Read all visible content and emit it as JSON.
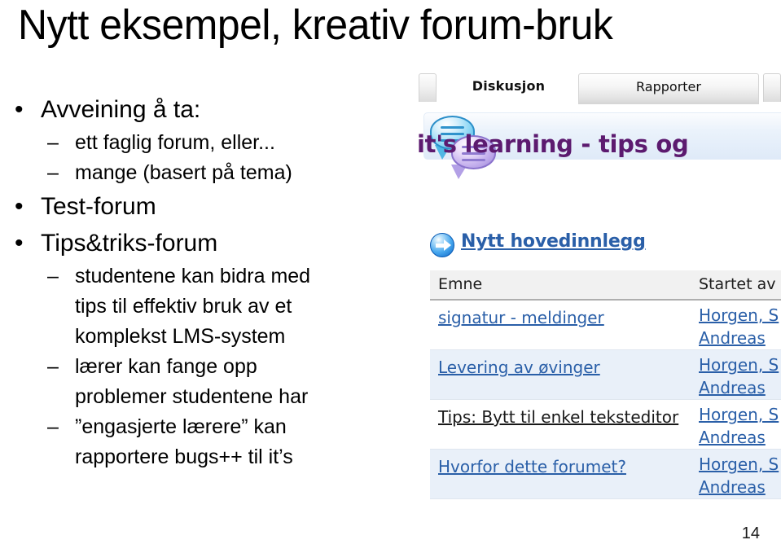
{
  "slide": {
    "title": "Nytt eksempel, kreativ forum-bruk",
    "number": "14",
    "bullet_mark_level1": "•",
    "bullet_mark_level2": "–",
    "bullets": [
      {
        "level": 1,
        "text": "Avveining å ta:"
      },
      {
        "level": 2,
        "text": "ett faglig forum, eller..."
      },
      {
        "level": 2,
        "text": "mange (basert på tema)"
      },
      {
        "level": 1,
        "text": "Test-forum"
      },
      {
        "level": 1,
        "text": "Tips&triks-forum"
      },
      {
        "level": 2,
        "lines": [
          "studentene kan bidra med",
          "tips til effektiv bruk av et",
          "komplekst LMS-system"
        ]
      },
      {
        "level": 2,
        "lines": [
          "lærer kan fange opp",
          "problemer studentene har"
        ]
      },
      {
        "level": 2,
        "lines": [
          "”engasjerte lærere” kan",
          "rapportere bugs++ til it’s"
        ]
      }
    ]
  },
  "screenshot": {
    "tabs": [
      {
        "label": "Diskusjon",
        "active": true
      },
      {
        "label": "Rapporter",
        "active": false
      }
    ],
    "forum_title": "it's learning - tips og",
    "forum_title_color": "#5c1a6f",
    "forum_icon_blue": "speech-bubble-blue-icon",
    "forum_icon_purple": "speech-bubble-purple-icon",
    "new_post": {
      "label": "Nytt hovedinnlegg",
      "icon": "arrow-right-circle-icon"
    },
    "table": {
      "columns": [
        "Emne",
        "Startet av"
      ],
      "rows": [
        {
          "topic": "signatur - meldinger",
          "author_first": "Horgen, S",
          "author_second": "Andreas",
          "visited": false
        },
        {
          "topic": "Levering av øvinger",
          "author_first": "Horgen, S",
          "author_second": "Andreas",
          "visited": false
        },
        {
          "topic": "Tips: Bytt til enkel teksteditor",
          "author_first": "Horgen, S",
          "author_second": "Andreas",
          "visited": true
        },
        {
          "topic": "Hvorfor dette forumet?",
          "author_first": "Horgen, S",
          "author_second": "Andreas",
          "visited": false
        }
      ]
    },
    "link_color": "#2a5fa8",
    "visited_link_color": "#181818",
    "row_alt_color": "#e9f0f9"
  }
}
